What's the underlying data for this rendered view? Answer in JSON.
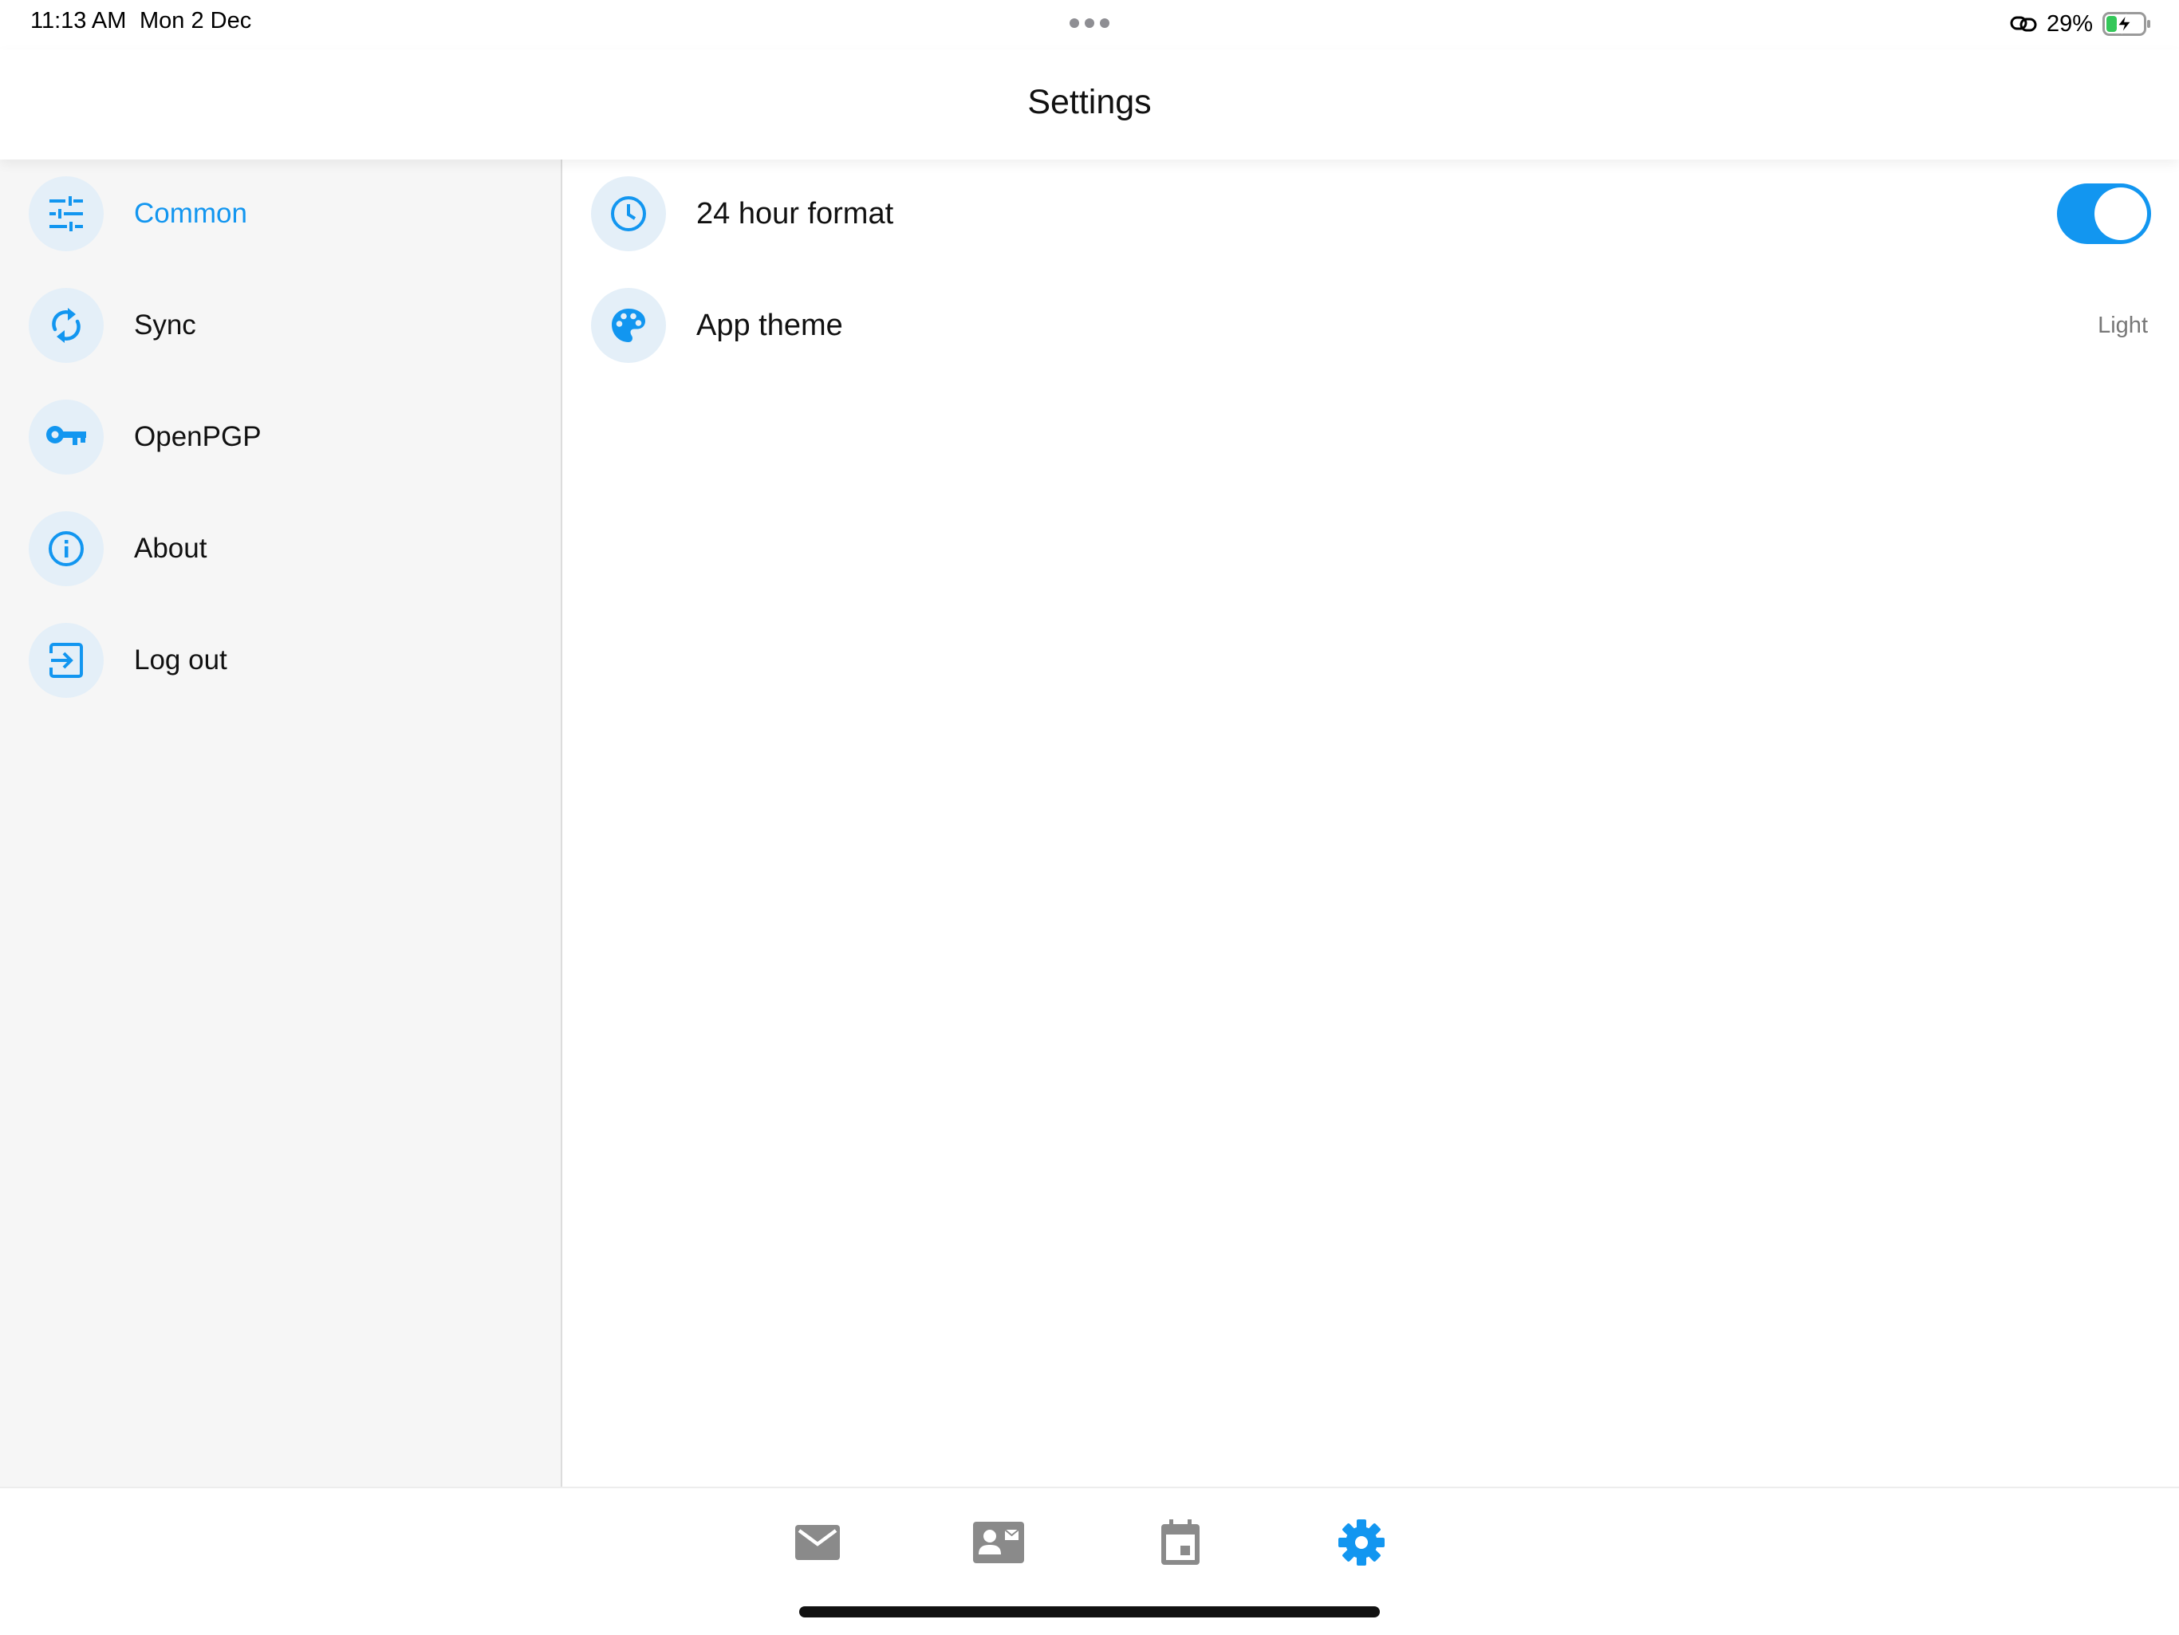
{
  "status_bar": {
    "time": "11:13 AM",
    "date": "Mon 2 Dec",
    "battery_percent": "29%",
    "battery_level": 0.29,
    "battery_charging": true,
    "icons": [
      "multitask-dots-icon",
      "link-icon",
      "battery-charging-icon"
    ]
  },
  "header": {
    "title": "Settings"
  },
  "sidebar": {
    "items": [
      {
        "label": "Common",
        "icon": "sliders-icon",
        "active": true
      },
      {
        "label": "Sync",
        "icon": "sync-icon",
        "active": false
      },
      {
        "label": "OpenPGP",
        "icon": "key-icon",
        "active": false
      },
      {
        "label": "About",
        "icon": "info-icon",
        "active": false
      },
      {
        "label": "Log out",
        "icon": "logout-icon",
        "active": false
      }
    ]
  },
  "settings": {
    "hour_format": {
      "label": "24 hour format",
      "icon": "clock-icon",
      "enabled": true
    },
    "app_theme": {
      "label": "App theme",
      "icon": "palette-icon",
      "value": "Light"
    }
  },
  "tab_bar": {
    "tabs": [
      {
        "name": "mail",
        "icon": "mail-icon",
        "active": false
      },
      {
        "name": "contacts",
        "icon": "contact-card-icon",
        "active": false
      },
      {
        "name": "calendar",
        "icon": "calendar-icon",
        "active": false
      },
      {
        "name": "settings",
        "icon": "gear-icon",
        "active": true
      }
    ]
  },
  "colors": {
    "accent": "#1296f0",
    "icon_circle_bg": "#e4eff8",
    "sidebar_bg": "#f6f6f6",
    "inactive_tab_icon": "#8a8a8a",
    "battery_green": "#34c759"
  }
}
